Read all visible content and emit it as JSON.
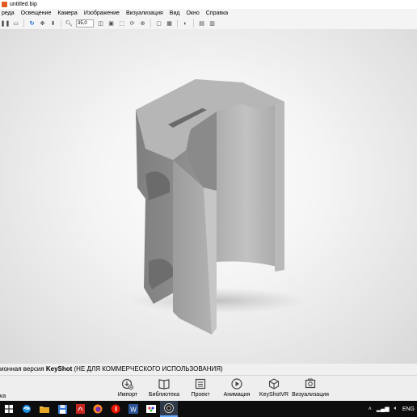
{
  "window": {
    "title": "untitled.bip"
  },
  "menu": [
    "реда",
    "Освещение",
    "Камера",
    "Изображение",
    "Визуализация",
    "Вид",
    "Окно",
    "Справка"
  ],
  "toolbar": {
    "zoom_value": "35,0"
  },
  "status": {
    "prefix": "ионная версия ",
    "brand": "KeyShot",
    "suffix": " (НЕ ДЛЯ КОММЕРЧЕСКОГО ИСПОЛЬЗОВАНИЯ)"
  },
  "bottom": {
    "left_label": "ка",
    "buttons": [
      {
        "label": "Импорт",
        "icon": "import-icon"
      },
      {
        "label": "Библиотека",
        "icon": "library-icon"
      },
      {
        "label": "Проект",
        "icon": "project-icon"
      },
      {
        "label": "Анимация",
        "icon": "animation-icon"
      },
      {
        "label": "KeyShotVR",
        "icon": "keyshotvr-icon"
      },
      {
        "label": "Визуализация",
        "icon": "render-icon"
      }
    ]
  },
  "taskbar": {
    "lang": "ENG"
  }
}
